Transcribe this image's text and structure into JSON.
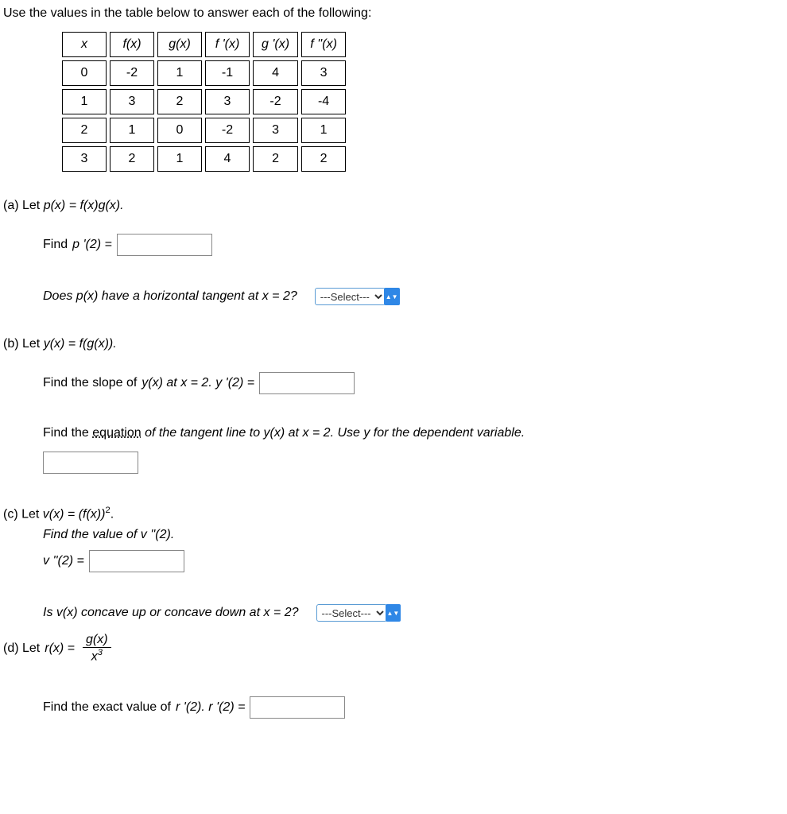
{
  "intro": "Use the values in the table below to answer each of the following:",
  "chart_data": {
    "type": "table",
    "columns": [
      "x",
      "f(x)",
      "g(x)",
      "f '(x)",
      "g '(x)",
      "f ''(x)"
    ],
    "rows": [
      [
        0,
        -2,
        1,
        -1,
        4,
        3
      ],
      [
        1,
        3,
        2,
        3,
        -2,
        -4
      ],
      [
        2,
        1,
        0,
        -2,
        3,
        1
      ],
      [
        3,
        2,
        1,
        4,
        2,
        2
      ]
    ]
  },
  "headers": {
    "c0": "x",
    "c1": "f(x)",
    "c2": "g(x)",
    "c3": "f '(x)",
    "c4": "g '(x)",
    "c5": "f ''(x)"
  },
  "cells": {
    "r0c0": "0",
    "r0c1": "-2",
    "r0c2": "1",
    "r0c3": "-1",
    "r0c4": "4",
    "r0c5": "3",
    "r1c0": "1",
    "r1c1": "3",
    "r1c2": "2",
    "r1c3": "3",
    "r1c4": "-2",
    "r1c5": "-4",
    "r2c0": "2",
    "r2c1": "1",
    "r2c2": "0",
    "r2c3": "-2",
    "r2c4": "3",
    "r2c5": "1",
    "r3c0": "3",
    "r3c1": "2",
    "r3c2": "1",
    "r3c3": "4",
    "r3c4": "2",
    "r3c5": "2"
  },
  "parts": {
    "a": {
      "lead": "(a) Let ",
      "def": "p(x) = f(x)g(x).",
      "find_label": "Find ",
      "find_expr": "p '(2) =",
      "tangent_q": "Does p(x) have a horizontal tangent at x = 2?",
      "select_placeholder": "---Select---"
    },
    "b": {
      "lead": "(b) Let ",
      "def": "y(x) = f(g(x)).",
      "slope_q_pre": "Find the slope of ",
      "slope_q_mid": "y(x) at x = 2. y '(2) =",
      "eq_pre": "Find the ",
      "eq_link": "equation",
      "eq_post": " of the tangent line to y(x) at x = 2. Use y for the dependent variable."
    },
    "c": {
      "lead": "(c) Let ",
      "def_pre": "v(x) = (f(x))",
      "def_exp": "2",
      "def_post": ".",
      "find_label": "Find the value of v ''(2).",
      "expr": "v ''(2) =",
      "concave_q": "Is v(x) concave up or concave down at x = 2?",
      "select_placeholder": "---Select---"
    },
    "d": {
      "lead": "(d) Let  ",
      "def_pre": "r(x) = ",
      "frac_num": "g(x)",
      "frac_den_base": "x",
      "frac_den_exp": "3",
      "find_pre": "Find the exact value of ",
      "find_expr": "r '(2). r '(2) ="
    }
  }
}
